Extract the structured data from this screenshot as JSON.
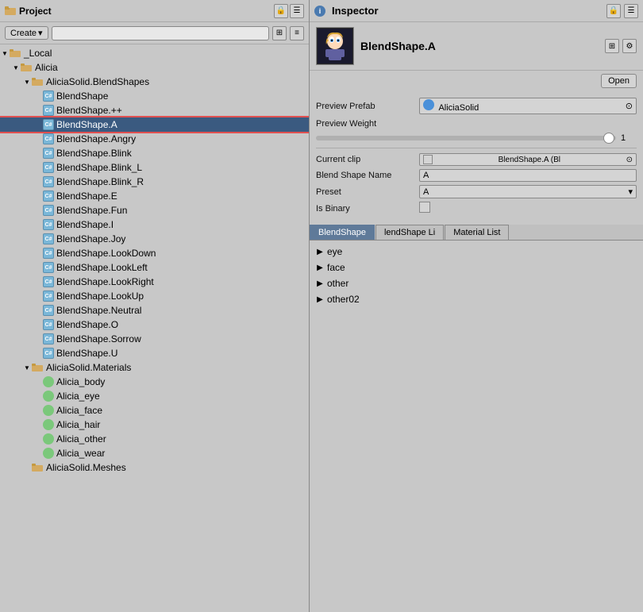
{
  "project": {
    "title": "Project",
    "create_label": "Create",
    "search_placeholder": "",
    "tree": [
      {
        "id": "local",
        "label": "_Local",
        "indent": 0,
        "type": "folder",
        "expanded": true,
        "arrow": "▼"
      },
      {
        "id": "alicia",
        "label": "Alicia",
        "indent": 1,
        "type": "folder",
        "expanded": true,
        "arrow": "▼"
      },
      {
        "id": "alicia-blendshapes",
        "label": "AliciaSolid.BlendShapes",
        "indent": 2,
        "type": "folder",
        "expanded": true,
        "arrow": "▼"
      },
      {
        "id": "bs-base",
        "label": "BlendShape",
        "indent": 3,
        "type": "script",
        "expanded": false,
        "arrow": ""
      },
      {
        "id": "bs-pp",
        "label": "BlendShape.++",
        "indent": 3,
        "type": "script",
        "expanded": false,
        "arrow": ""
      },
      {
        "id": "bs-a",
        "label": "BlendShape.A",
        "indent": 3,
        "type": "script",
        "expanded": false,
        "arrow": "",
        "selected": true,
        "highlighted": true
      },
      {
        "id": "bs-angry",
        "label": "BlendShape.Angry",
        "indent": 3,
        "type": "script",
        "expanded": false,
        "arrow": ""
      },
      {
        "id": "bs-blink",
        "label": "BlendShape.Blink",
        "indent": 3,
        "type": "script",
        "expanded": false,
        "arrow": ""
      },
      {
        "id": "bs-blink-l",
        "label": "BlendShape.Blink_L",
        "indent": 3,
        "type": "script",
        "expanded": false,
        "arrow": ""
      },
      {
        "id": "bs-blink-r",
        "label": "BlendShape.Blink_R",
        "indent": 3,
        "type": "script",
        "expanded": false,
        "arrow": ""
      },
      {
        "id": "bs-e",
        "label": "BlendShape.E",
        "indent": 3,
        "type": "script",
        "expanded": false,
        "arrow": ""
      },
      {
        "id": "bs-fun",
        "label": "BlendShape.Fun",
        "indent": 3,
        "type": "script",
        "expanded": false,
        "arrow": ""
      },
      {
        "id": "bs-i",
        "label": "BlendShape.I",
        "indent": 3,
        "type": "script",
        "expanded": false,
        "arrow": ""
      },
      {
        "id": "bs-joy",
        "label": "BlendShape.Joy",
        "indent": 3,
        "type": "script",
        "expanded": false,
        "arrow": ""
      },
      {
        "id": "bs-lookdown",
        "label": "BlendShape.LookDown",
        "indent": 3,
        "type": "script",
        "expanded": false,
        "arrow": ""
      },
      {
        "id": "bs-lookleft",
        "label": "BlendShape.LookLeft",
        "indent": 3,
        "type": "script",
        "expanded": false,
        "arrow": ""
      },
      {
        "id": "bs-lookright",
        "label": "BlendShape.LookRight",
        "indent": 3,
        "type": "script",
        "expanded": false,
        "arrow": ""
      },
      {
        "id": "bs-lookup",
        "label": "BlendShape.LookUp",
        "indent": 3,
        "type": "script",
        "expanded": false,
        "arrow": ""
      },
      {
        "id": "bs-neutral",
        "label": "BlendShape.Neutral",
        "indent": 3,
        "type": "script",
        "expanded": false,
        "arrow": ""
      },
      {
        "id": "bs-o",
        "label": "BlendShape.O",
        "indent": 3,
        "type": "script",
        "expanded": false,
        "arrow": ""
      },
      {
        "id": "bs-sorrow",
        "label": "BlendShape.Sorrow",
        "indent": 3,
        "type": "script",
        "expanded": false,
        "arrow": ""
      },
      {
        "id": "bs-u",
        "label": "BlendShape.U",
        "indent": 3,
        "type": "script",
        "expanded": false,
        "arrow": ""
      },
      {
        "id": "alicia-materials",
        "label": "AliciaSolid.Materials",
        "indent": 2,
        "type": "folder",
        "expanded": true,
        "arrow": "▼"
      },
      {
        "id": "body",
        "label": "Alicia_body",
        "indent": 3,
        "type": "material",
        "expanded": false,
        "arrow": ""
      },
      {
        "id": "eye",
        "label": "Alicia_eye",
        "indent": 3,
        "type": "material",
        "expanded": false,
        "arrow": ""
      },
      {
        "id": "face",
        "label": "Alicia_face",
        "indent": 3,
        "type": "material",
        "expanded": false,
        "arrow": ""
      },
      {
        "id": "hair",
        "label": "Alicia_hair",
        "indent": 3,
        "type": "material",
        "expanded": false,
        "arrow": ""
      },
      {
        "id": "other",
        "label": "Alicia_other",
        "indent": 3,
        "type": "material",
        "expanded": false,
        "arrow": ""
      },
      {
        "id": "wear",
        "label": "Alicia_wear",
        "indent": 3,
        "type": "material",
        "expanded": false,
        "arrow": ""
      },
      {
        "id": "alicia-meshes",
        "label": "AliciaSolid.Meshes",
        "indent": 2,
        "type": "folder",
        "expanded": false,
        "arrow": ""
      }
    ]
  },
  "inspector": {
    "title": "Inspector",
    "asset_name": "BlendShape.A",
    "open_label": "Open",
    "preview_prefab_label": "Preview Prefab",
    "preview_prefab_value": "AliciaSolid",
    "preview_weight_label": "Preview Weight",
    "preview_weight_value": "1",
    "current_clip_label": "Current clip",
    "current_clip_value": "BlendShape.A (Bl",
    "blend_shape_name_label": "Blend Shape Name",
    "blend_shape_name_value": "A",
    "preset_label": "Preset",
    "preset_value": "A",
    "is_binary_label": "Is Binary",
    "tabs": [
      {
        "id": "blendshape",
        "label": "BlendShape",
        "active": true
      },
      {
        "id": "lendshape-li",
        "label": "lendShape Li",
        "active": false
      },
      {
        "id": "material-list",
        "label": "Material List",
        "active": false
      }
    ],
    "tree_items": [
      {
        "id": "eye",
        "label": "eye"
      },
      {
        "id": "face",
        "label": "face"
      },
      {
        "id": "other",
        "label": "other"
      },
      {
        "id": "other02",
        "label": "other02"
      }
    ]
  }
}
